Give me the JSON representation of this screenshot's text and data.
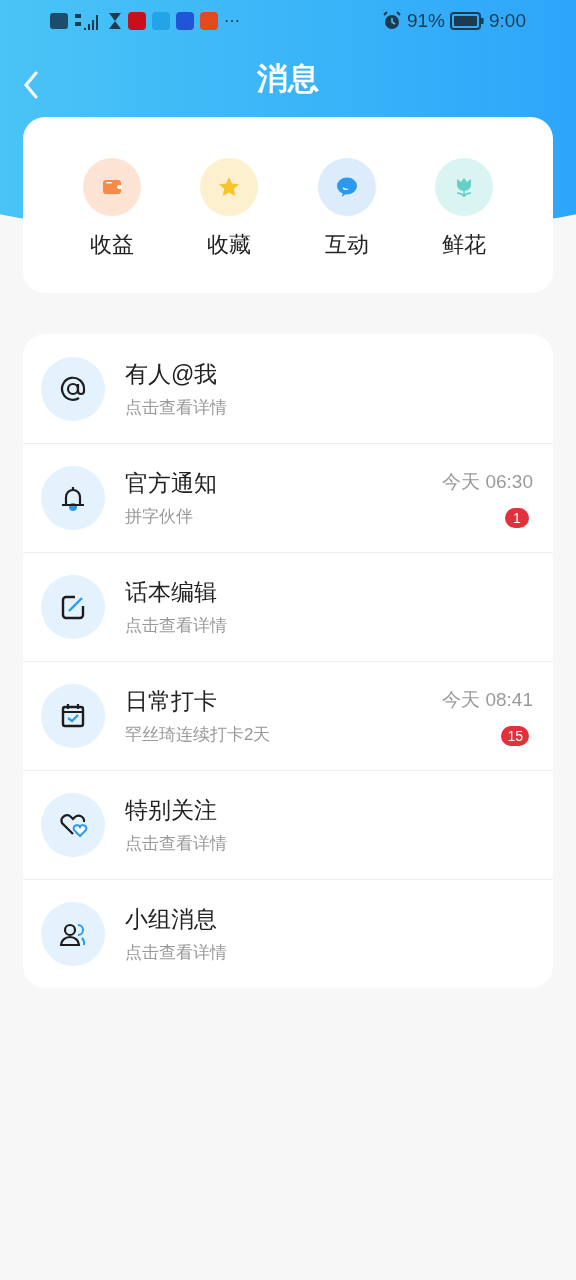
{
  "status_bar": {
    "more": "⋯",
    "battery_percent": "91%",
    "time": "9:00"
  },
  "header": {
    "title": "消息"
  },
  "shortcuts": [
    {
      "kind": "wallet",
      "label": "收益"
    },
    {
      "kind": "star",
      "label": "收藏"
    },
    {
      "kind": "chat",
      "label": "互动"
    },
    {
      "kind": "flower",
      "label": "鲜花"
    }
  ],
  "messages": [
    {
      "kind": "mention",
      "title": "有人@我",
      "subtitle": "点击查看详情"
    },
    {
      "kind": "notice",
      "title": "官方通知",
      "subtitle": "拼字伙伴",
      "time": "今天 06:30",
      "badge": "1"
    },
    {
      "kind": "edit",
      "title": "话本编辑",
      "subtitle": "点击查看详情"
    },
    {
      "kind": "checkin",
      "title": "日常打卡",
      "subtitle": "罕丝琦连续打卡2天",
      "time": "今天 08:41",
      "badge": "15"
    },
    {
      "kind": "follow",
      "title": "特别关注",
      "subtitle": "点击查看详情"
    },
    {
      "kind": "group",
      "title": "小组消息",
      "subtitle": "点击查看详情"
    }
  ]
}
